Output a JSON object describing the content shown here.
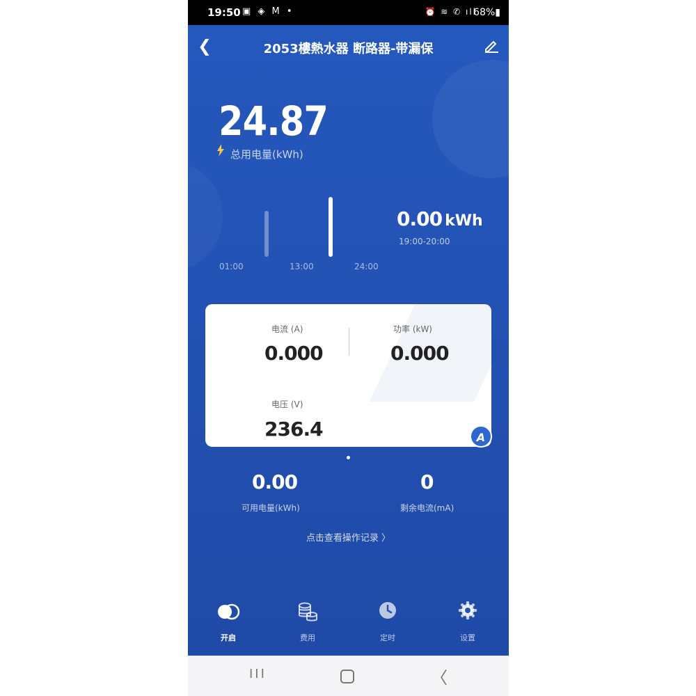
{
  "status_bar": {
    "time": "19:50",
    "left_icons": "▣ ◈ M •",
    "right_icons": "⏰ ≋ ✆ ıll",
    "battery": "68%▮"
  },
  "header": {
    "title": "2053樓熱水器 断路器-带漏保"
  },
  "summary": {
    "total_value": "24.87",
    "total_label": "总用电量(kWh)"
  },
  "chart_data": {
    "type": "bar",
    "x_ticks": [
      "01:00",
      "13:00",
      "24:00"
    ],
    "selected_value": "0.00",
    "selected_unit": "kWh",
    "selected_range": "19:00-20:00"
  },
  "card": {
    "current_label": "电流 (A)",
    "current_value": "0.000",
    "power_label": "功率 (kW)",
    "power_value": "0.000",
    "voltage_label": "电压 (V)",
    "voltage_value": "236.4",
    "badge": "A"
  },
  "metrics": {
    "available_value": "0.00",
    "available_label": "可用电量(kWh)",
    "leakage_value": "0",
    "leakage_label": "剩余电流(mA)"
  },
  "records_link": "点击查看操作记录 〉",
  "bottom_nav": [
    {
      "label": "开启",
      "icon": "toggle-icon"
    },
    {
      "label": "费用",
      "icon": "coins-icon"
    },
    {
      "label": "定时",
      "icon": "clock-icon"
    },
    {
      "label": "设置",
      "icon": "gear-icon"
    }
  ],
  "system_nav": {
    "recents": "III",
    "back": "〈"
  },
  "colors": {
    "accent": "#2352b4",
    "card": "#ffffff",
    "badge": "#2f66d0"
  }
}
